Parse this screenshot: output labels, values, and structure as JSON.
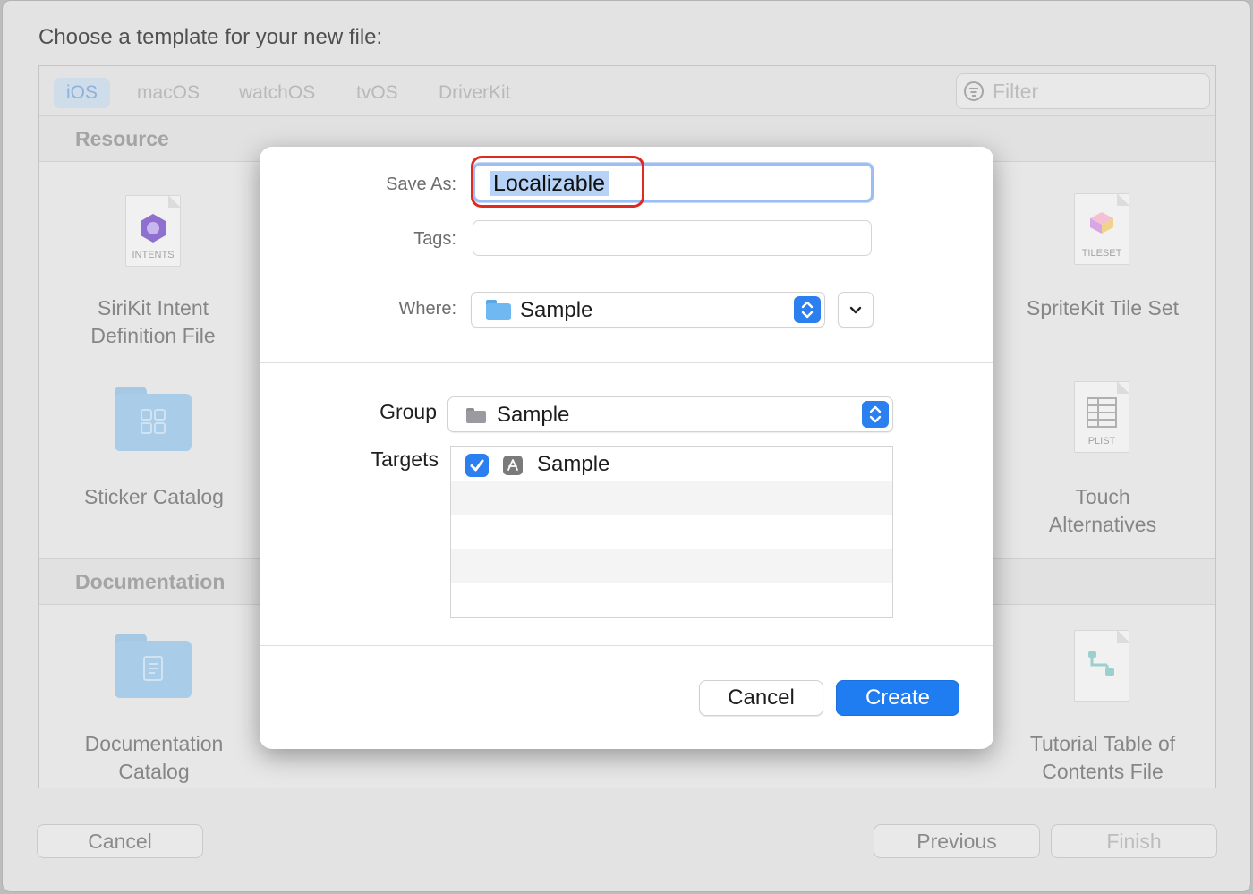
{
  "window": {
    "heading": "Choose a template for your new file:",
    "platform_tabs": [
      "iOS",
      "macOS",
      "watchOS",
      "tvOS",
      "DriverKit"
    ],
    "filter_placeholder": "Filter",
    "sections": {
      "resource": "Resource",
      "documentation": "Documentation"
    },
    "tiles": {
      "sirikit_label_1": "SiriKit Intent",
      "sirikit_label_2": "Definition File",
      "sirikit_icon_caption": "INTENTS",
      "spritekit_label": "SpriteKit Tile Set",
      "spritekit_icon_caption": "TILESET",
      "sticker_label": "Sticker Catalog",
      "touch_label_1": "Touch",
      "touch_label_2": "Alternatives",
      "touch_icon_caption": "PLIST",
      "doc_catalog_label_1": "Documentation",
      "doc_catalog_label_2": "Catalog",
      "tutorial_label_1": "Tutorial Table of",
      "tutorial_label_2": "Contents File"
    },
    "buttons": {
      "cancel": "Cancel",
      "previous": "Previous",
      "finish": "Finish"
    }
  },
  "dialog": {
    "save_as_label": "Save As:",
    "save_as_value": "Localizable",
    "tags_label": "Tags:",
    "where_label": "Where:",
    "where_value": "Sample",
    "group_label": "Group",
    "group_value": "Sample",
    "targets_label": "Targets",
    "targets": [
      {
        "name": "Sample",
        "checked": true
      }
    ],
    "cancel_label": "Cancel",
    "create_label": "Create"
  }
}
